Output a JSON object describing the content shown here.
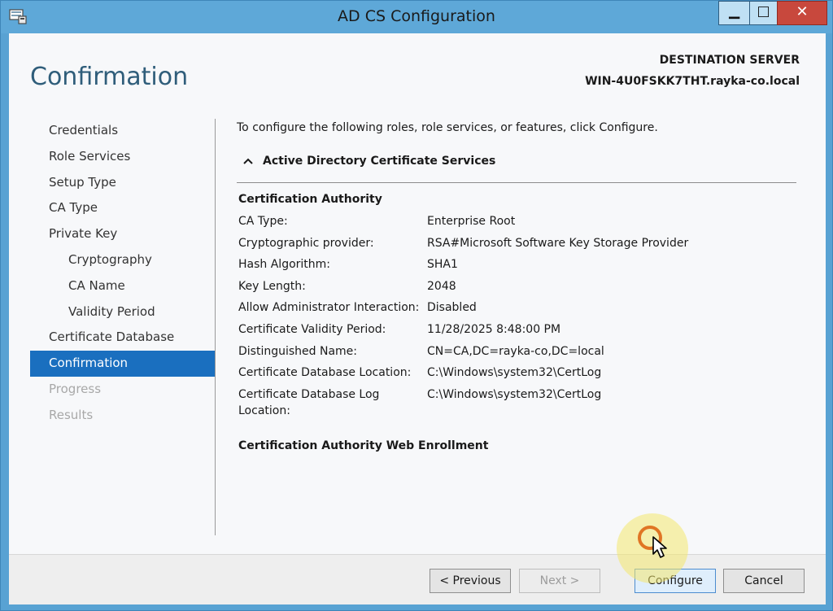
{
  "window": {
    "title": "AD CS Configuration",
    "controls": {
      "minimize": "▁",
      "maximize": "□",
      "close": "✕"
    }
  },
  "header": {
    "page_title": "Confirmation",
    "destination_label": "DESTINATION SERVER",
    "destination_server": "WIN-4U0FSKK7THT.rayka-co.local"
  },
  "nav": {
    "items": [
      {
        "label": "Credentials",
        "state": "normal"
      },
      {
        "label": "Role Services",
        "state": "normal"
      },
      {
        "label": "Setup Type",
        "state": "normal"
      },
      {
        "label": "CA Type",
        "state": "normal"
      },
      {
        "label": "Private Key",
        "state": "normal"
      },
      {
        "label": "Cryptography",
        "state": "sub"
      },
      {
        "label": "CA Name",
        "state": "sub"
      },
      {
        "label": "Validity Period",
        "state": "sub"
      },
      {
        "label": "Certificate Database",
        "state": "normal"
      },
      {
        "label": "Confirmation",
        "state": "active"
      },
      {
        "label": "Progress",
        "state": "disabled"
      },
      {
        "label": "Results",
        "state": "disabled"
      }
    ]
  },
  "content": {
    "intro": "To configure the following roles, role services, or features, click Configure.",
    "section": "Active Directory Certificate Services",
    "ca_heading": "Certification Authority",
    "rows": [
      {
        "key": "CA Type:",
        "value": "Enterprise Root"
      },
      {
        "key": "Cryptographic provider:",
        "value": "RSA#Microsoft Software Key Storage Provider"
      },
      {
        "key": "Hash Algorithm:",
        "value": "SHA1"
      },
      {
        "key": "Key Length:",
        "value": "2048"
      },
      {
        "key": "Allow Administrator Interaction:",
        "value": "Disabled"
      },
      {
        "key": "Certificate Validity Period:",
        "value": "11/28/2025 8:48:00 PM"
      },
      {
        "key": "Distinguished Name:",
        "value": "CN=CA,DC=rayka-co,DC=local"
      },
      {
        "key": "Certificate Database Location:",
        "value": "C:\\Windows\\system32\\CertLog"
      },
      {
        "key": "Certificate Database Log Location:",
        "value": "C:\\Windows\\system32\\CertLog"
      }
    ],
    "web_enrollment_heading": "Certification Authority Web Enrollment"
  },
  "footer": {
    "previous": "< Previous",
    "next": "Next >",
    "configure": "Configure",
    "cancel": "Cancel"
  },
  "colors": {
    "title_bar": "#5ea8d8",
    "active_nav": "#1a6fbf",
    "page_title": "#2f5d7a",
    "close_button": "#c8483d"
  }
}
